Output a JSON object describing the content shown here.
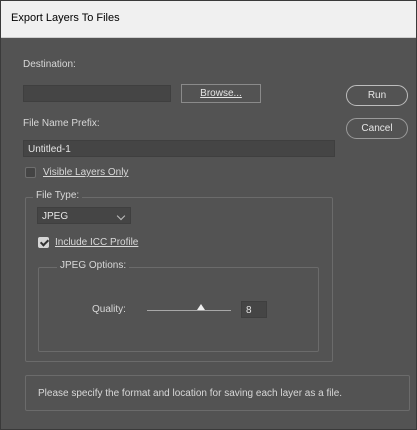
{
  "window": {
    "title": "Export Layers To Files"
  },
  "destination": {
    "label": "Destination:",
    "value": "",
    "browse_label": "Browse..."
  },
  "prefix": {
    "label": "File Name Prefix:",
    "value": "Untitled-1"
  },
  "visible_only": {
    "label": "Visible Layers Only",
    "checked": false
  },
  "file_type": {
    "legend": "File Type:",
    "selected": "JPEG",
    "include_icc": {
      "label": "Include ICC Profile",
      "checked": true
    },
    "jpeg_options": {
      "legend": "JPEG Options:",
      "quality_label": "Quality:",
      "quality_value": "8",
      "quality_min": 0,
      "quality_max": 12
    }
  },
  "buttons": {
    "run": "Run",
    "cancel": "Cancel"
  },
  "status_message": "Please specify the format and location for saving each layer as a file."
}
